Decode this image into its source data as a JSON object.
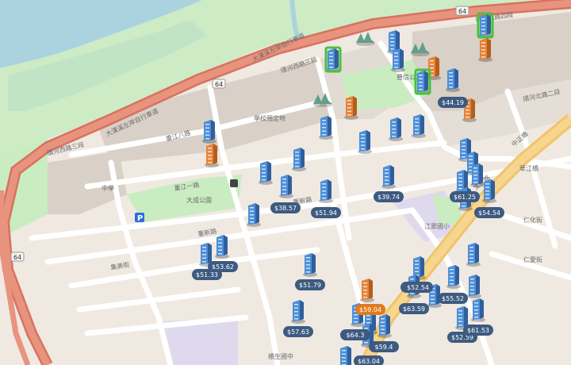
{
  "map": {
    "road_number": "64",
    "road_number_top": "64"
  },
  "labels": {
    "huanhe_west_4": "環河西路四段",
    "dahan_river_trail": "大漢溪左岸自行車道",
    "huanhe_west_3": "環河西路三段",
    "huanhe_west_3b": "環河西路三段",
    "huanhe_west_5": "環河西路五段",
    "school_site": "學校預定地",
    "chongjiang_8": "重江八路",
    "chongjiang_9": "重江九路",
    "huanhe_north_2": "環河北路二段",
    "fengxin_park": "豐信公園",
    "chongjiang_1": "重江一路",
    "chongxin_rd": "重新路",
    "chongxin_rd_2": "重新路",
    "jixin_st": "集美街",
    "dacheng_park": "大成公園",
    "zhongzheng_bridge": "中正橋",
    "wenhua_rd": "文化路",
    "jiangcui_school": "江翠國小",
    "ziqiang_rd": "自強路",
    "sanhe_rd": "三和路",
    "renai_st": "仁愛街",
    "renhua_st": "仁化街",
    "datong_rd": "大同路",
    "huatong": "華江橋",
    "river_school_left": "中學",
    "qiaosheng": "橋生國中"
  },
  "price_labels": [
    "$44.19",
    "$38.57",
    "$51.94",
    "$39.74",
    "$61.25",
    "$54.54",
    "$53.62",
    "$51.33",
    "$51.79",
    "$57.03",
    "$55.52",
    "$63.59",
    "$52.54",
    "$57.63",
    "$64.3",
    "$59.4",
    "$63.04",
    "$52.59",
    "$61.53",
    "$59.04"
  ],
  "icons": {
    "building_blue": "building-blue-icon",
    "building_orange": "building-orange-icon",
    "building_green": "building-green-icon",
    "mountain": "hill-icon",
    "parking": "parking-icon",
    "bus": "bus-icon"
  },
  "colors": {
    "highway": "#e8866f",
    "park": "#c9ecc1",
    "water": "#aad3df",
    "block": "#d9d0c7",
    "price_bg": "#3d5a80",
    "price_active": "#e07b1f"
  }
}
